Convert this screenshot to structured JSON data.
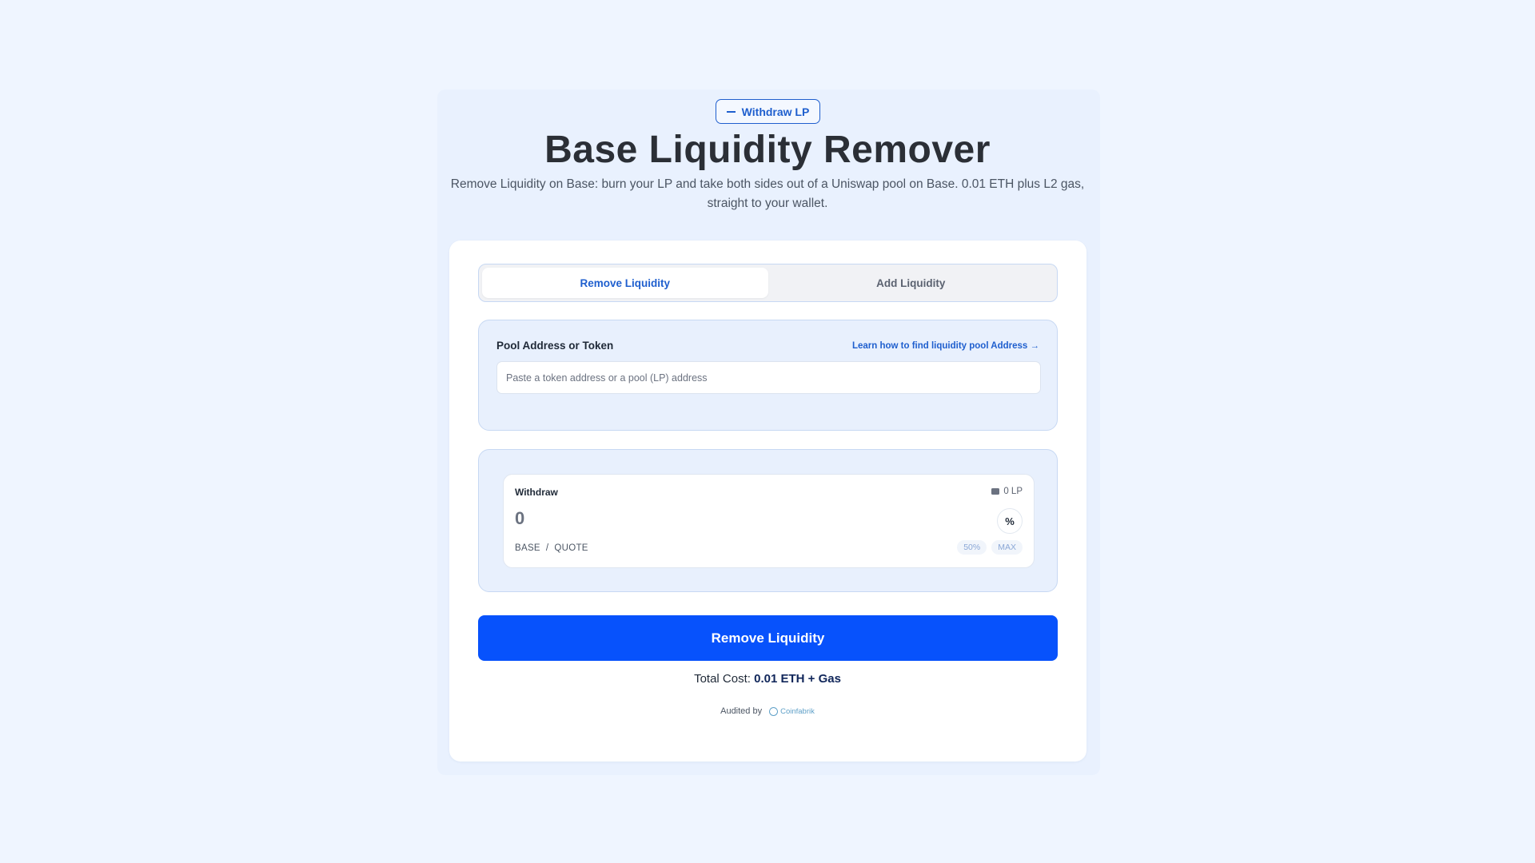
{
  "header": {
    "badge_label": "Withdraw LP",
    "title": "Base Liquidity Remover",
    "subtitle": "Remove Liquidity on Base: burn your LP and take both sides out of a Uniswap pool on Base. 0.01 ETH plus L2 gas, straight to your wallet."
  },
  "tabs": [
    {
      "label": "Remove Liquidity",
      "active": true
    },
    {
      "label": "Add Liquidity",
      "active": false
    }
  ],
  "pool": {
    "label": "Pool Address or Token",
    "help_link": "Learn how to find liquidity pool Address →",
    "input_value": "",
    "input_placeholder": "Paste a token address or a pool (LP) address"
  },
  "withdraw": {
    "label": "Withdraw",
    "balance": "0 LP",
    "amount": "0",
    "percent_button": "%",
    "pair": "BASE  /  QUOTE",
    "quick_options": [
      "50%",
      "MAX"
    ]
  },
  "action": {
    "button_label": "Remove Liquidity",
    "total_cost_label": "Total Cost:",
    "total_cost_value": "0.01 ETH + Gas"
  },
  "audit": {
    "label": "Audited by",
    "auditor": "Coinfabrik"
  },
  "colors": {
    "accent": "#0752fc",
    "link": "#1f5fce",
    "background": "#eff5ff",
    "panel": "#e8f0fd"
  },
  "icons": {
    "badge": "minus-icon",
    "balance": "wallet-icon",
    "auditor": "coinfabrik-logo-icon"
  }
}
